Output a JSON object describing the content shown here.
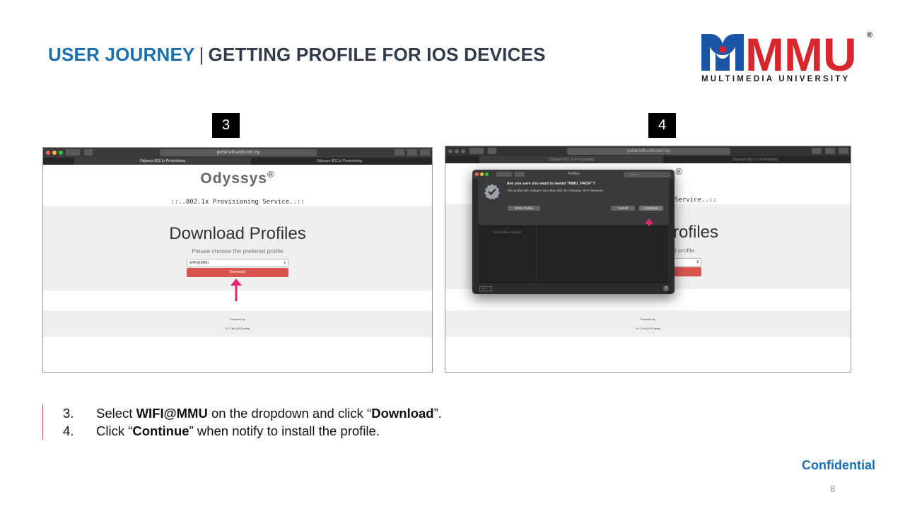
{
  "header": {
    "title_part1": "USER JOURNEY",
    "separator": "|",
    "title_part2": "GETTING PROFILE FOR IOS DEVICES"
  },
  "logo": {
    "text": "MMU",
    "registered": "®",
    "subtitle": "MULTIMEDIA UNIVERSITY",
    "blue": "#1a56a6",
    "red": "#d9262c"
  },
  "steps": [
    {
      "label": "3",
      "browser": {
        "url": "portal.wifi.unifi.com.my",
        "tabs": [
          "Odyssys 802.1x Provisioning",
          "Odyssys 802.1x Provisioning"
        ]
      },
      "page": {
        "brand": "Odyssys",
        "brand_mark": "®",
        "service": "::..802.1x Provisioning Service..::",
        "heading": "Download Profiles",
        "subheading": "Please choose the prefered profile",
        "select_value": "WIFI@MMU",
        "button": "Download",
        "powered": "Powered By",
        "version": "V1.2.0b (UCS beta)"
      }
    },
    {
      "label": "4",
      "browser": {
        "url": "portal.wifi.unifi.com.my",
        "tabs": [
          "Odyssys 802.1x Provisioning",
          "Odyssys 802.1x Provisioning"
        ]
      },
      "page": {
        "brand_partial": "ys",
        "brand_mark": "®",
        "service_partial": "Service..::",
        "heading_partial": "rofiles",
        "subheading_partial": "d profile",
        "powered": "Powered By",
        "version": "V1.2.0b (UCS beta)"
      },
      "dialog": {
        "title": "Profiles",
        "search_placeholder": "Search",
        "question": "Are you sure you want to install \"MMU_PROF\"?",
        "description": "This profile will configure your Mac with the following: Wi-Fi Network.",
        "show_profile": "Show Profile",
        "cancel": "Cancel",
        "continue": "Continue",
        "no_profiles": "No profiles installed",
        "add_remove": "+ −",
        "help": "?"
      }
    }
  ],
  "instructions": [
    {
      "num": "3.",
      "pre": "Select ",
      "bold1": "WIFI@MMU",
      "mid": " on the dropdown and click “",
      "bold2": "Download",
      "post": "”."
    },
    {
      "num": "4.",
      "pre": "Click “",
      "bold1": "Continue",
      "mid": "” when notify to install the profile.",
      "bold2": "",
      "post": ""
    }
  ],
  "footer": {
    "confidential": "Confidential",
    "page_number": "8"
  },
  "colors": {
    "title_blue": "#1a6fb0",
    "title_dark": "#2f3a4a",
    "download_red": "#d9534f",
    "arrow_pink": "#e0266e"
  }
}
